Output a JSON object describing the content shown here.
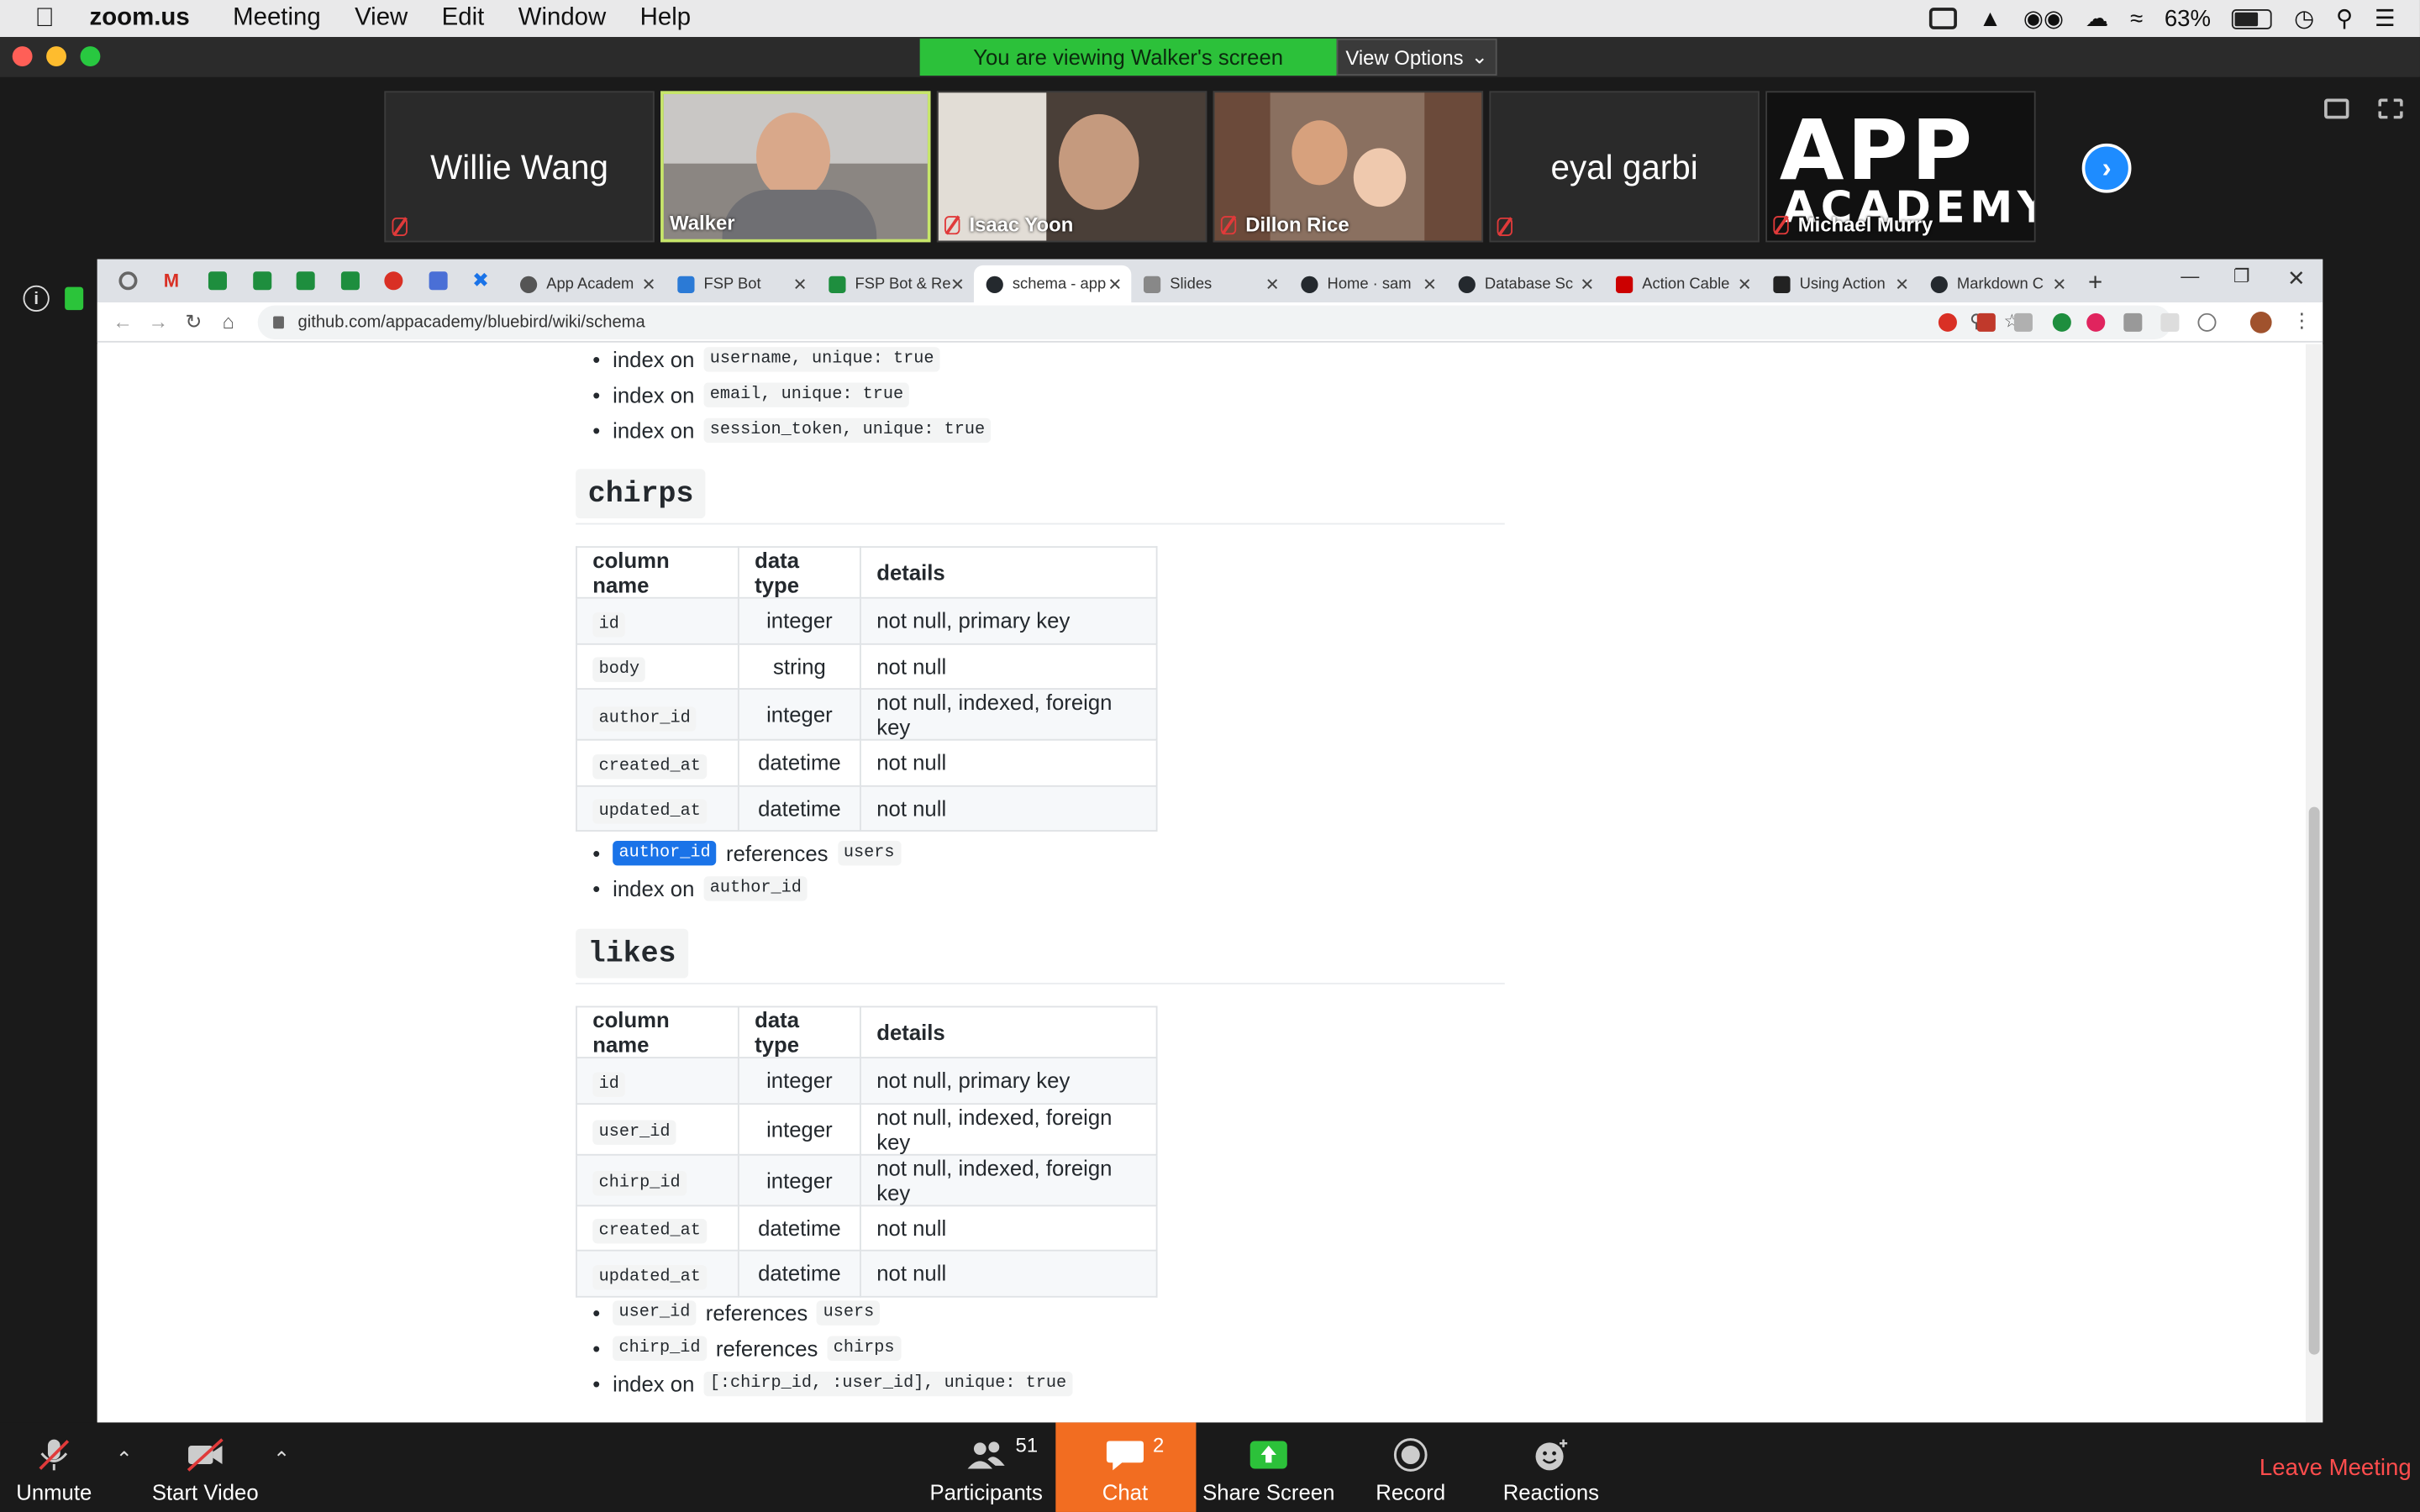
{
  "menubar": {
    "app": "zoom.us",
    "items": [
      "Meeting",
      "View",
      "Edit",
      "Window",
      "Help"
    ],
    "battery": "63%"
  },
  "zoom": {
    "banner": "You are viewing Walker's screen",
    "view_options": "View Options",
    "participants": [
      {
        "name": "Willie Wang",
        "video": false
      },
      {
        "name": "Walker",
        "video": true
      },
      {
        "name": "Isaac Yoon",
        "video": true
      },
      {
        "name": "Dillon Rice",
        "video": true
      },
      {
        "name": "eyal garbi",
        "video": false
      },
      {
        "name": "Michael Murry",
        "video": true
      }
    ],
    "app_logo_top": "APP",
    "app_logo_bottom": "ACADEMY"
  },
  "browser": {
    "tabs": [
      {
        "label": "App Academ",
        "color": "#555"
      },
      {
        "label": "FSP Bot",
        "color": "#2b7ad6"
      },
      {
        "label": "FSP Bot & Re",
        "color": "#1e8e3e"
      },
      {
        "label": "schema - app",
        "color": "#24292e"
      },
      {
        "label": "Slides",
        "color": "#888"
      },
      {
        "label": "Home · sam",
        "color": "#24292e"
      },
      {
        "label": "Database Sc",
        "color": "#24292e"
      },
      {
        "label": "Action Cable",
        "color": "#cc0000"
      },
      {
        "label": "Using Action",
        "color": "#222"
      },
      {
        "label": "Markdown C",
        "color": "#24292e"
      }
    ],
    "url": "github.com/appacademy/bluebird/wiki/schema"
  },
  "doc": {
    "top_bullets": [
      {
        "prefix": "index on",
        "code": "username, unique: true"
      },
      {
        "prefix": "index on",
        "code": "email, unique: true"
      },
      {
        "prefix": "index on",
        "code": "session_token, unique: true"
      }
    ],
    "chirps": {
      "heading": "chirps",
      "headers": [
        "column name",
        "data type",
        "details"
      ],
      "rows": [
        [
          "id",
          "integer",
          "not null, primary key"
        ],
        [
          "body",
          "string",
          "not null"
        ],
        [
          "author_id",
          "integer",
          "not null, indexed, foreign key"
        ],
        [
          "created_at",
          "datetime",
          "not null"
        ],
        [
          "updated_at",
          "datetime",
          "not null"
        ]
      ],
      "b1_code": "author_id",
      "b1_text": "references",
      "b1_code2": "users",
      "b2_text": "index on",
      "b2_code": "author_id"
    },
    "likes": {
      "heading": "likes",
      "headers": [
        "column name",
        "data type",
        "details"
      ],
      "rows": [
        [
          "id",
          "integer",
          "not null, primary key"
        ],
        [
          "user_id",
          "integer",
          "not null, indexed, foreign key"
        ],
        [
          "chirp_id",
          "integer",
          "not null, indexed, foreign key"
        ],
        [
          "created_at",
          "datetime",
          "not null"
        ],
        [
          "updated_at",
          "datetime",
          "not null"
        ]
      ],
      "b1_code": "user_id",
      "b1_text": "references",
      "b1_code2": "users",
      "b2_code": "chirp_id",
      "b2_text": "references",
      "b2_code2": "chirps",
      "b3_text": "index on",
      "b3_code": "[:chirp_id, :user_id], unique: true"
    }
  },
  "controls": {
    "unmute": "Unmute",
    "start_video": "Start Video",
    "participants": "Participants",
    "participants_count": "51",
    "chat": "Chat",
    "chat_count": "2",
    "share": "Share Screen",
    "record": "Record",
    "reactions": "Reactions",
    "leave": "Leave Meeting"
  }
}
